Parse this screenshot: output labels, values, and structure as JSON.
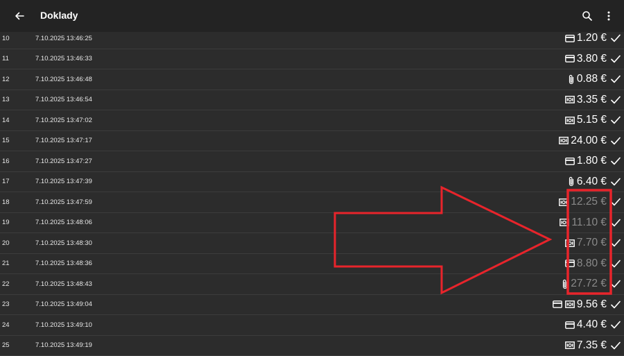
{
  "appbar": {
    "title": "Doklady",
    "back_icon": "arrow-left-icon",
    "search_icon": "search-icon",
    "more_icon": "more-vert-icon"
  },
  "colors": {
    "appbar_bg": "#232323",
    "list_bg": "#2c2c2c",
    "annotation": "#e8242b",
    "dim_amount": "#8a8a8a"
  },
  "rows": [
    {
      "index": "10",
      "datetime": "7.10.2025 13:46:25",
      "icons": [
        "card-icon"
      ],
      "amount": "1.20",
      "currency": "€",
      "dimmed": false
    },
    {
      "index": "11",
      "datetime": "7.10.2025 13:46:33",
      "icons": [
        "card-icon"
      ],
      "amount": "3.80",
      "currency": "€",
      "dimmed": false
    },
    {
      "index": "12",
      "datetime": "7.10.2025 13:46:48",
      "icons": [
        "paperclip-icon"
      ],
      "amount": "0.88",
      "currency": "€",
      "dimmed": false
    },
    {
      "index": "13",
      "datetime": "7.10.2025 13:46:54",
      "icons": [
        "cash-icon"
      ],
      "amount": "3.35",
      "currency": "€",
      "dimmed": false
    },
    {
      "index": "14",
      "datetime": "7.10.2025 13:47:02",
      "icons": [
        "cash-icon"
      ],
      "amount": "5.15",
      "currency": "€",
      "dimmed": false
    },
    {
      "index": "15",
      "datetime": "7.10.2025 13:47:17",
      "icons": [
        "cash-icon"
      ],
      "amount": "24.00",
      "currency": "€",
      "dimmed": false
    },
    {
      "index": "16",
      "datetime": "7.10.2025 13:47:27",
      "icons": [
        "card-icon"
      ],
      "amount": "1.80",
      "currency": "€",
      "dimmed": false
    },
    {
      "index": "17",
      "datetime": "7.10.2025 13:47:39",
      "icons": [
        "paperclip-icon"
      ],
      "amount": "6.40",
      "currency": "€",
      "dimmed": false
    },
    {
      "index": "18",
      "datetime": "7.10.2025 13:47:59",
      "icons": [
        "cash-icon"
      ],
      "amount": "12.25",
      "currency": "€",
      "dimmed": true
    },
    {
      "index": "19",
      "datetime": "7.10.2025 13:48:06",
      "icons": [
        "cash-icon"
      ],
      "amount": "11.10",
      "currency": "€",
      "dimmed": true
    },
    {
      "index": "20",
      "datetime": "7.10.2025 13:48:30",
      "icons": [
        "cash-icon"
      ],
      "amount": "7.70",
      "currency": "€",
      "dimmed": true
    },
    {
      "index": "21",
      "datetime": "7.10.2025 13:48:36",
      "icons": [
        "card-icon"
      ],
      "amount": "8.80",
      "currency": "€",
      "dimmed": true
    },
    {
      "index": "22",
      "datetime": "7.10.2025 13:48:43",
      "icons": [
        "paperclip-icon"
      ],
      "amount": "27.72",
      "currency": "€",
      "dimmed": true
    },
    {
      "index": "23",
      "datetime": "7.10.2025 13:49:04",
      "icons": [
        "card-icon",
        "cash-icon"
      ],
      "amount": "9.56",
      "currency": "€",
      "dimmed": false
    },
    {
      "index": "24",
      "datetime": "7.10.2025 13:49:10",
      "icons": [
        "card-icon"
      ],
      "amount": "4.40",
      "currency": "€",
      "dimmed": false
    },
    {
      "index": "25",
      "datetime": "7.10.2025 13:49:19",
      "icons": [
        "cash-icon"
      ],
      "amount": "7.35",
      "currency": "€",
      "dimmed": false
    }
  ],
  "row_check_icon": "check-icon"
}
